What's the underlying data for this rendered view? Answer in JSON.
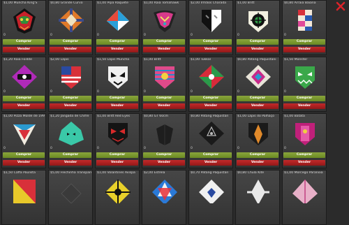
{
  "shop": {
    "buy_label": "Comprar",
    "sell_label": "Vender",
    "rows": [
      [
        {
          "name": "$1,00 Muncha King'S",
          "qty": "0"
        },
        {
          "name": "$0,80 Grande Curvo",
          "qty": "0"
        },
        {
          "name": "$1,00 Pipa Raquete",
          "qty": "0"
        },
        {
          "name": "$1,00 Raia Tomahawk",
          "qty": "0"
        },
        {
          "name": "$2,00 Irmãos Charada",
          "qty": "0"
        },
        {
          "name": "$1,00 Britt",
          "qty": "0"
        },
        {
          "name": "$0,80 Arraia Baiana",
          "qty": "0"
        }
      ],
      [
        {
          "name": "$1,20 Raia Foillde",
          "qty": "0"
        },
        {
          "name": "$2,00 Lápis",
          "qty": "0"
        },
        {
          "name": "$1,50 Lápis Muncha",
          "qty": "0"
        },
        {
          "name": "$1,00 Britt",
          "qty": "0"
        },
        {
          "name": "$1,00 Tukkal",
          "qty": "0"
        },
        {
          "name": "$0,80 Patang Paquistani",
          "qty": "0"
        },
        {
          "name": "$1,50 Monster",
          "qty": "0"
        }
      ],
      [
        {
          "name": "$1,00 Pizza Molde de 1998",
          "qty": "0"
        },
        {
          "name": "$1,20 Jangada de Chifre",
          "qty": "0"
        },
        {
          "name": "$1,00 Britt Red Eyes",
          "qty": "0"
        },
        {
          "name": "$0,80 GT 60cm",
          "qty": "0"
        },
        {
          "name": "$0,80 Patang Paquistan",
          "qty": "0"
        },
        {
          "name": "$1,00 Lápis do Palhaço",
          "qty": "0"
        },
        {
          "name": "$1,00 Batata",
          "qty": "0"
        }
      ],
      [
        {
          "name": "$1,50 Caffa Paulista",
          "qty": ""
        },
        {
          "name": "$5,00 Flechinha Transparente",
          "qty": ""
        },
        {
          "name": "$1,00 Volantines Avispa",
          "qty": ""
        },
        {
          "name": "$2,00 Estrela",
          "qty": ""
        },
        {
          "name": "$0,70 Patang Paquistan",
          "qty": ""
        },
        {
          "name": "$0,80 Chula Kite",
          "qty": ""
        },
        {
          "name": "$1,00 Morcego Paranoia",
          "qty": ""
        }
      ]
    ]
  },
  "colors": {
    "buy_button": "#7a9a2e",
    "sell_button": "#b01f1f",
    "close_icon": "#d9232a"
  },
  "icons": {
    "close": "close-x-icon"
  }
}
